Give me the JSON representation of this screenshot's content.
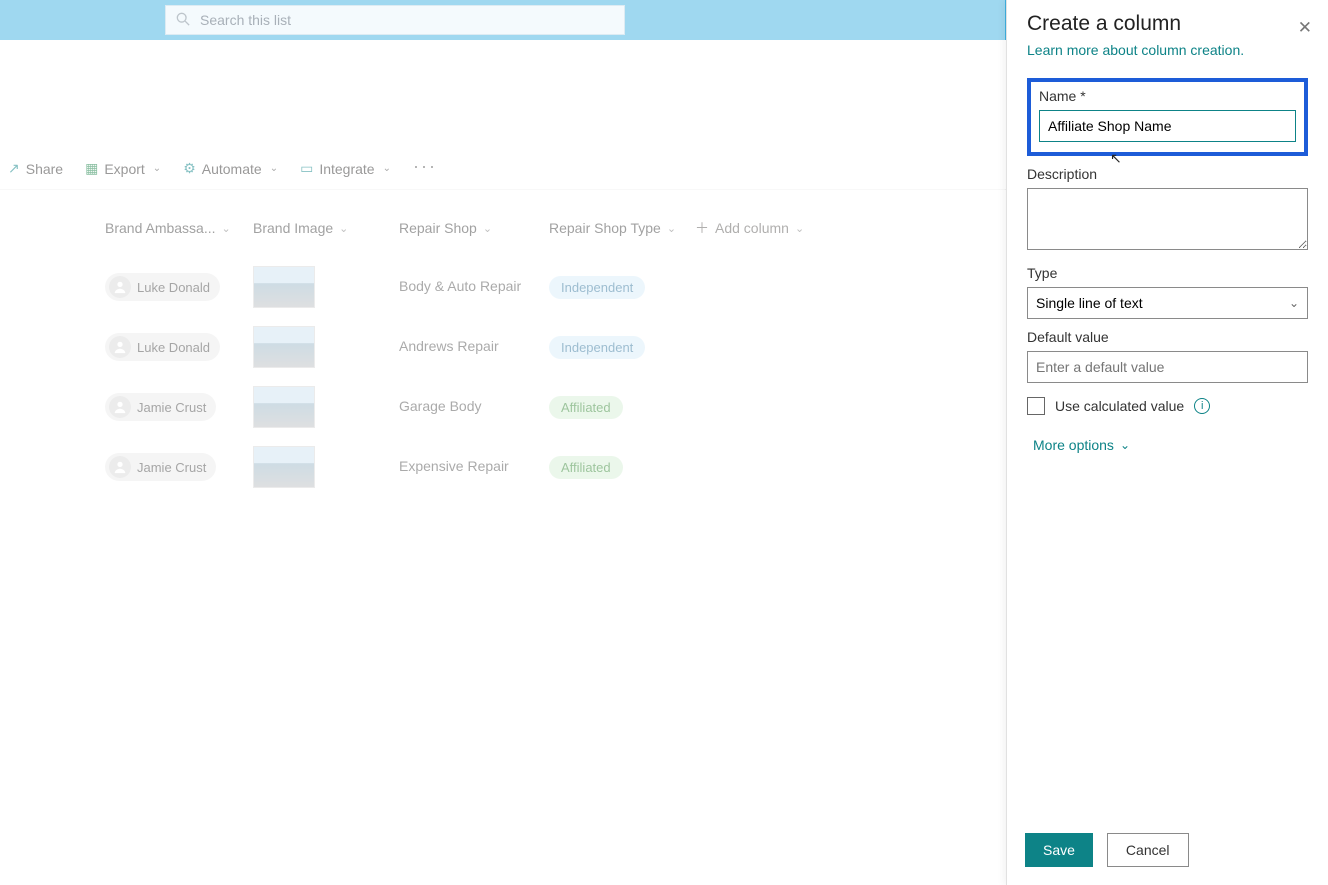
{
  "search": {
    "placeholder": "Search this list"
  },
  "commands": {
    "share": "Share",
    "export": "Export",
    "automate": "Automate",
    "integrate": "Integrate"
  },
  "columns": {
    "ambassador": "Brand Ambassa...",
    "brandImage": "Brand Image",
    "repairShop": "Repair Shop",
    "repairShopType": "Repair Shop Type",
    "addColumn": "Add column"
  },
  "rows": [
    {
      "ambassador": "Luke Donald",
      "shop": "Body & Auto Repair",
      "typeLabel": "Independent",
      "typeClass": "tag-indep"
    },
    {
      "ambassador": "Luke Donald",
      "shop": "Andrews Repair",
      "typeLabel": "Independent",
      "typeClass": "tag-indep"
    },
    {
      "ambassador": "Jamie Crust",
      "shop": "Garage Body",
      "typeLabel": "Affiliated",
      "typeClass": "tag-affil"
    },
    {
      "ambassador": "Jamie Crust",
      "shop": "Expensive Repair",
      "typeLabel": "Affiliated",
      "typeClass": "tag-affil"
    }
  ],
  "panel": {
    "title": "Create a column",
    "learnLink": "Learn more about column creation.",
    "nameLabel": "Name *",
    "nameValue": "Affiliate Shop Name",
    "descLabel": "Description",
    "typeLabel": "Type",
    "typeValue": "Single line of text",
    "defaultLabel": "Default value",
    "defaultPlaceholder": "Enter a default value",
    "calcLabel": "Use calculated value",
    "moreOptions": "More options",
    "save": "Save",
    "cancel": "Cancel"
  }
}
